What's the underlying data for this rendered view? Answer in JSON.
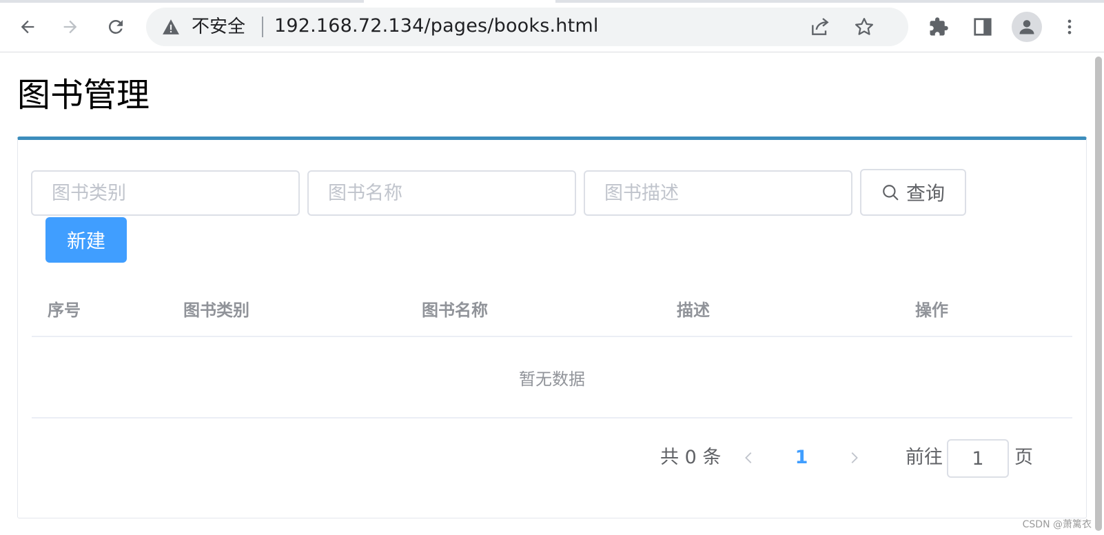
{
  "browser": {
    "security_label": "不安全",
    "url": "192.168.72.134/pages/books.html",
    "icons": {
      "back": "arrow-left-icon",
      "forward": "arrow-right-icon",
      "reload": "reload-icon",
      "security": "warning-triangle-icon",
      "share": "share-icon",
      "bookmark": "star-icon",
      "extensions": "puzzle-icon",
      "side_panel": "side-panel-icon",
      "profile": "person-icon",
      "menu": "kebab-menu-icon"
    }
  },
  "page": {
    "title": "图书管理"
  },
  "filters": {
    "category_placeholder": "图书类别",
    "name_placeholder": "图书名称",
    "description_placeholder": "图书描述",
    "query_label": "查询",
    "new_label": "新建"
  },
  "table": {
    "columns": [
      "序号",
      "图书类别",
      "图书名称",
      "描述",
      "操作"
    ],
    "rows": [],
    "empty_text": "暂无数据"
  },
  "pagination": {
    "total_text": "共 0 条",
    "current_page": "1",
    "goto_label": "前往",
    "goto_value": "1",
    "page_suffix": "页"
  },
  "watermark": "CSDN @萧篱衣",
  "colors": {
    "accent": "#409eff",
    "box_border_top": "#3c8dbc",
    "header_text": "#909399"
  }
}
